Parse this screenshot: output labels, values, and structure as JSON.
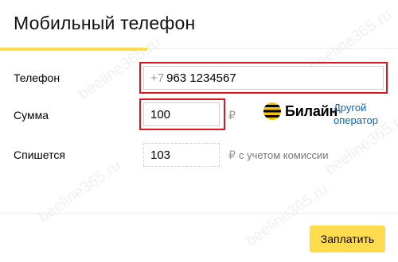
{
  "header": {
    "title": "Мобильный телефон"
  },
  "form": {
    "phone": {
      "label": "Телефон",
      "prefix": "+7",
      "value": "963 1234567"
    },
    "amount": {
      "label": "Сумма",
      "value": "100",
      "currency": "₽"
    },
    "deduct": {
      "label": "Спишется",
      "value": "103",
      "currency": "₽",
      "note": "с учетом комиссии"
    }
  },
  "operator": {
    "name": "Билайн",
    "logo_icon": "beeline-striped-circle-icon",
    "other_link_line1": "Другой",
    "other_link_line2": "оператор"
  },
  "footer": {
    "pay_label": "Заплатить"
  },
  "watermark": {
    "text": "beeline365.ru"
  },
  "colors": {
    "accent_yellow": "#ffdb4d",
    "highlight_red": "#e0141e",
    "link_blue": "#0066cc"
  }
}
